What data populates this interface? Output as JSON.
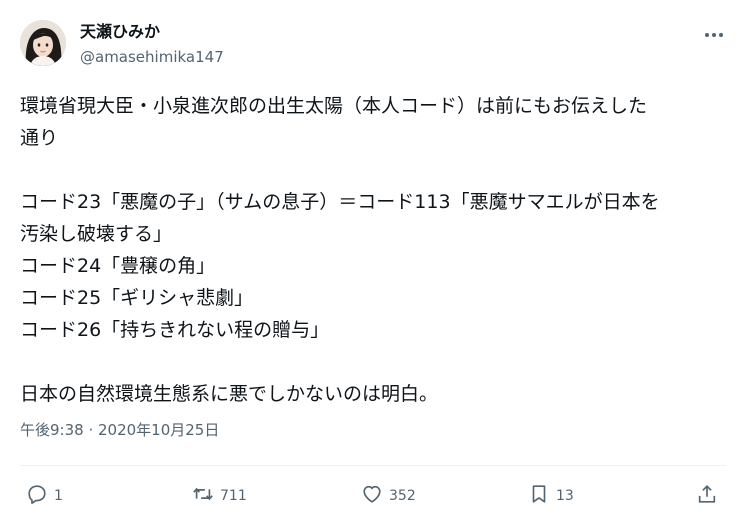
{
  "author": {
    "display_name": "天瀬ひみか",
    "handle": "@amasehimika147"
  },
  "tweet": {
    "lines": [
      "環境省現大臣・小泉進次郎の出生太陽（本人コード）は前にもお伝えした",
      "通り",
      "",
      "コード23「悪魔の子」（サムの息子）＝コード113「悪魔サマエルが日本を",
      "汚染し破壊する」",
      "コード24「豊穣の角」",
      "コード25「ギリシャ悲劇」",
      "コード26「持ちきれない程の贈与」",
      "",
      "日本の自然環境生態系に悪でしかないのは明白。"
    ],
    "timestamp": "午後9:38 · 2020年10月25日"
  },
  "actions": {
    "reply_count": "1",
    "retweet_count": "711",
    "like_count": "352",
    "bookmark_count": "13"
  },
  "icons": {
    "more": "more-horizontal-icon",
    "reply": "reply-icon",
    "retweet": "retweet-icon",
    "like": "heart-icon",
    "bookmark": "bookmark-icon",
    "share": "share-icon"
  },
  "colors": {
    "text": "#0f1419",
    "secondary": "#536471",
    "divider": "#eff3f4"
  }
}
